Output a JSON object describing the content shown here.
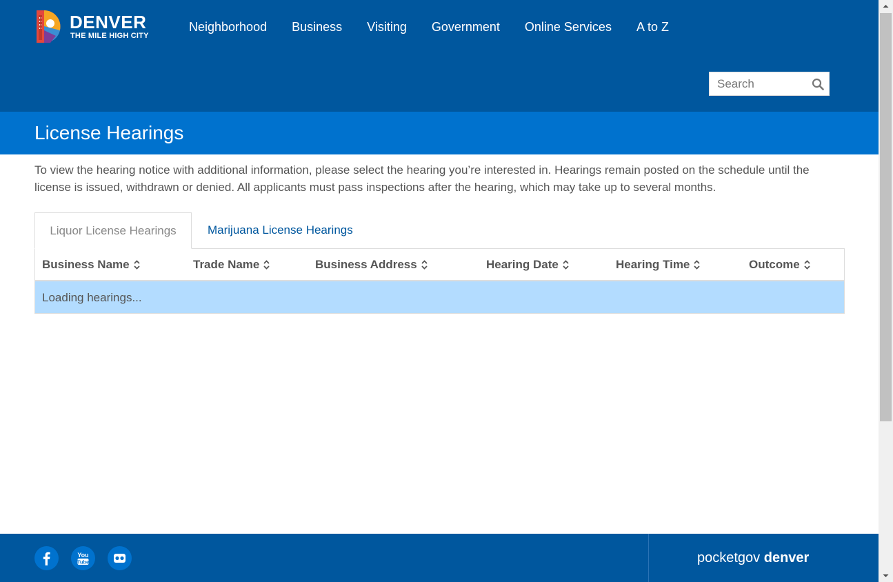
{
  "header": {
    "logo_title": "DENVER",
    "logo_subtitle": "THE MILE HIGH CITY",
    "nav": [
      "Neighborhood",
      "Business",
      "Visiting",
      "Government",
      "Online Services",
      "A to Z"
    ],
    "search": {
      "placeholder": "Search"
    },
    "colors": {
      "header_bg": "#00579e",
      "accent": "#0072ce"
    }
  },
  "page": {
    "title": "License Hearings",
    "intro": "To view the hearing notice with additional information, please select the hearing you’re interested in. Hearings remain posted on the schedule until the license is issued, withdrawn or denied. All applicants must pass inspections after the hearing, which may take up to several months."
  },
  "tabs": [
    {
      "label": "Liquor License Hearings",
      "active": true
    },
    {
      "label": "Marijuana License Hearings",
      "active": false
    }
  ],
  "table": {
    "columns": [
      "Business Name",
      "Trade Name",
      "Business Address",
      "Hearing Date",
      "Hearing Time",
      "Outcome"
    ],
    "status": "Loading hearings...",
    "status_color": "#b3dcff"
  },
  "footer": {
    "social_icons": [
      "facebook-icon",
      "youtube-icon",
      "flickr-icon"
    ],
    "youtube_glyph": "You Tube",
    "pocketgov_prefix": "pocketgov",
    "pocketgov_bold": "denver"
  }
}
